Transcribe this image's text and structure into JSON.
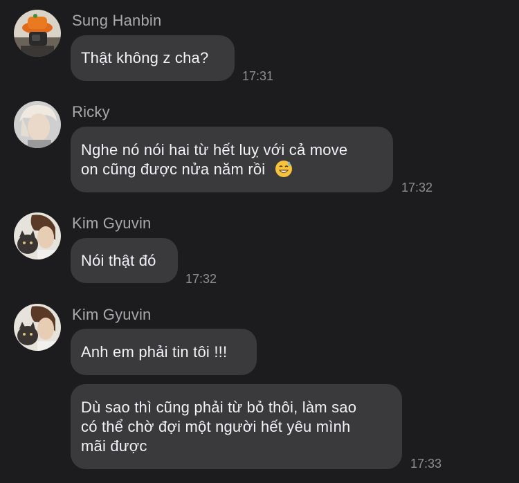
{
  "messages": [
    {
      "sender": "Sung Hanbin",
      "avatar_icon": "profile-photo-orange-hat",
      "text": "Thật không z cha?",
      "time": "17:31"
    },
    {
      "sender": "Ricky",
      "avatar_icon": "profile-photo-blond-hair",
      "line1": "Nghe nó nói hai từ hết luỵ với cả move",
      "line2": "on cũng được nửa năm rồi",
      "emoji_icon": "grinning-sweat-emoji",
      "time": "17:32"
    },
    {
      "sender": "Kim Gyuvin",
      "avatar_icon": "profile-photo-with-kitten",
      "text": "Nói thật đó",
      "time": "17:32"
    },
    {
      "sender": "Kim Gyuvin",
      "avatar_icon": "profile-photo-with-kitten",
      "bubbles": [
        {
          "text": "Anh em phải tin tôi !!!"
        },
        {
          "line1": "Dù sao thì cũng phải từ bỏ thôi, làm sao",
          "line2": "có thể chờ đợi một người hết yêu mình",
          "line3": "mãi được"
        }
      ],
      "time": "17:33"
    }
  ],
  "colors": {
    "background": "#1c1c1e",
    "bubble": "#3a3a3c",
    "message_text": "#f2f2f7",
    "sender_name": "#a9a9ae",
    "timestamp": "#8e8e93"
  }
}
